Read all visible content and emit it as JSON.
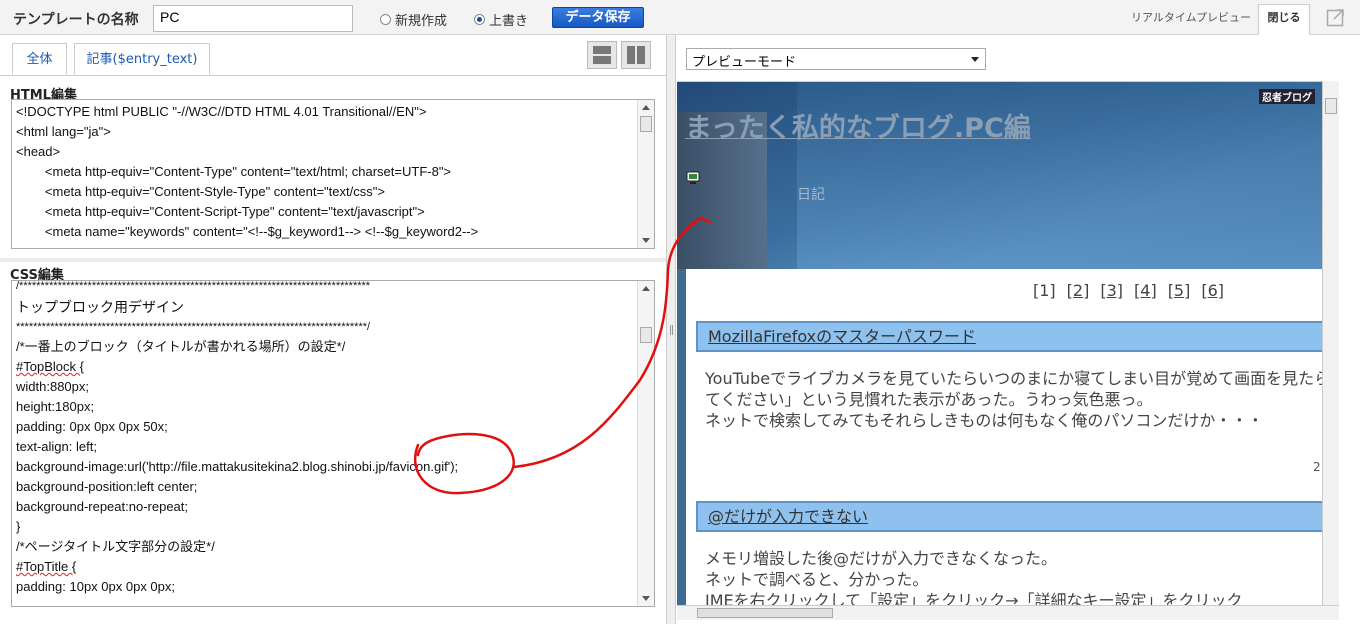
{
  "toolbar": {
    "template_label": "テンプレートの名称",
    "template_name": "PC",
    "radio_new": "新規作成",
    "radio_overwrite": "上書き",
    "radio_selected": "overwrite",
    "save_button": "データ保存",
    "realtime_preview_tab": "リアルタイムプレビュー",
    "close_tab": "閉じる",
    "popout_icon": "popout-icon"
  },
  "left": {
    "tabs": [
      {
        "label": "全体"
      },
      {
        "label": "記事($entry_text)"
      }
    ],
    "html_label": "HTML編集",
    "css_label": "CSS編集",
    "html_lines": [
      "<!DOCTYPE html PUBLIC \"-//W3C//DTD HTML 4.01 Transitional//EN\">",
      "<html lang=\"ja\">",
      "<head>",
      "        <meta http-equiv=\"Content-Type\" content=\"text/html; charset=UTF-8\">",
      "        <meta http-equiv=\"Content-Style-Type\" content=\"text/css\">",
      "        <meta http-equiv=\"Content-Script-Type\" content=\"text/javascript\">",
      "        <meta name=\"keywords\" content=\"<!--$g_keyword1--> <!--$g_keyword2-->"
    ],
    "css_lines": [
      "/**********************************************************************************",
      "トップブロック用デザイン",
      "**********************************************************************************/",
      "/*一番上のブロック（タイトルが書かれる場所）の設定*/",
      "#TopBlock {",
      "width:880px;",
      "height:180px;",
      "padding: 0px 0px 0px 50x;",
      "text-align: left;",
      "background-image:url('http://file.mattakusitekina2.blog.shinobi.jp/favicon.gif');",
      "background-position:left center;",
      "background-repeat:no-repeat;",
      "}",
      "/*ページタイトル文字部分の設定*/",
      "#TopTitle {",
      "padding: 10px 0px 0px 0px;"
    ]
  },
  "right": {
    "preview_mode": "プレビューモード",
    "blog": {
      "logo": "忍者ブログ",
      "title": "まったく私的なブログ.PC編",
      "subtitle": "日記",
      "pager": [
        "[1]",
        "[2]",
        "[3]",
        "[4]",
        "[5]",
        "[6]"
      ],
      "entries": [
        {
          "title": "MozillaFirefoxのマスターパスワード",
          "lines": [
            "YouTubeでライブカメラを見ていたらいつのまにか寝てしまい目が覚めて画面を見たら",
            "てください」という見慣れた表示があった。うわっ気色悪っ。",
            "ネットで検索してみてもそれらしきものは何もなく俺のパソコンだけか・・・"
          ],
          "number": "2"
        },
        {
          "title": "@だけが入力できない",
          "lines": [
            "メモリ増設した後@だけが入力できなくなった。",
            "ネットで調べると、分かった。",
            "IMEを右クリックして「設定」をクリック→「詳細なキー設定」をクリック"
          ]
        }
      ]
    }
  },
  "colors": {
    "accent": "#1558c4",
    "entry_title_bg": "#8fc1ef",
    "annotation": "#e01010"
  }
}
